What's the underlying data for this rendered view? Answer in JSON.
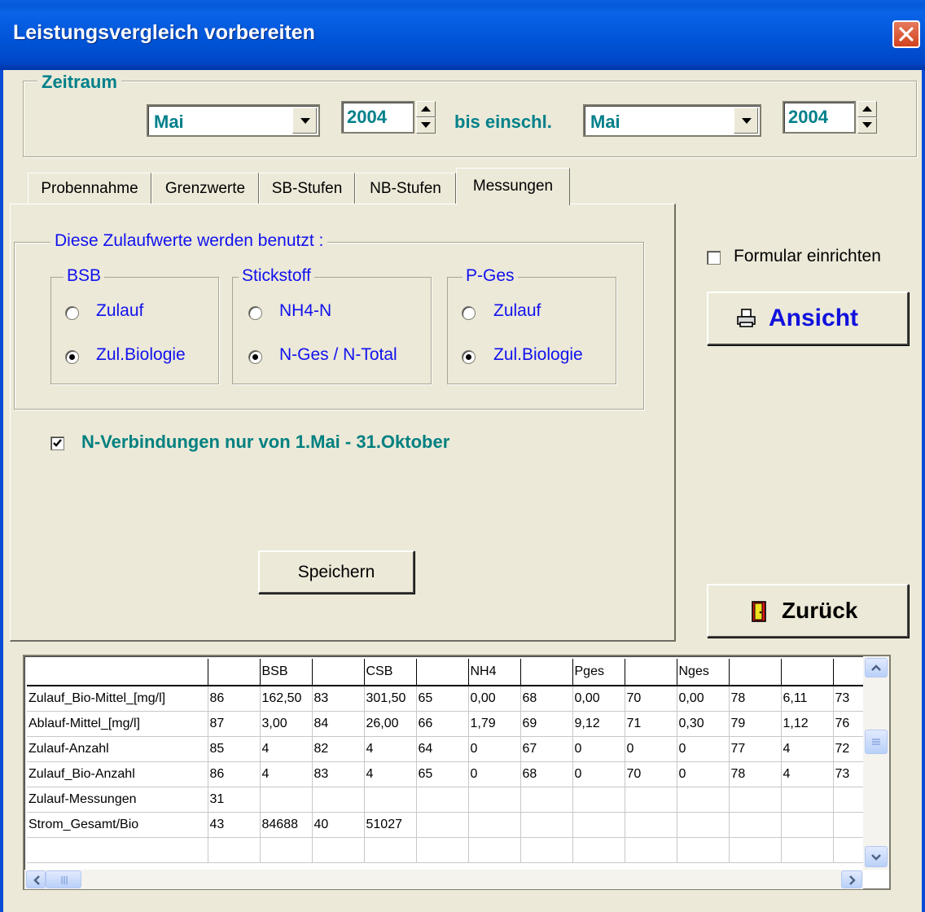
{
  "window": {
    "title": "Leistungsvergleich vorbereiten"
  },
  "zeitraum": {
    "label": "Zeitraum",
    "from_month": "Mai",
    "from_year": "2004",
    "bis_label": "bis einschl.",
    "to_month": "Mai",
    "to_year": "2004"
  },
  "tabs": [
    {
      "label": "Probennahme"
    },
    {
      "label": "Grenzwerte"
    },
    {
      "label": "SB-Stufen"
    },
    {
      "label": "NB-Stufen"
    },
    {
      "label": "Messungen",
      "active": true
    }
  ],
  "messungen": {
    "group_label": "Diese Zulaufwerte werden benutzt :",
    "bsb": {
      "label": "BSB",
      "opt1": "Zulauf",
      "opt2": "Zul.Biologie",
      "selected": "Zul.Biologie"
    },
    "stickstoff": {
      "label": "Stickstoff",
      "opt1": "NH4-N",
      "opt2": "N-Ges / N-Total",
      "selected": "N-Ges / N-Total"
    },
    "pges": {
      "label": "P-Ges",
      "opt1": "Zulauf",
      "opt2": "Zul.Biologie",
      "selected": "Zul.Biologie"
    },
    "nverb_label": "N-Verbindungen nur von 1.Mai - 31.Oktober",
    "nverb_checked": true,
    "save_label": "Speichern"
  },
  "right": {
    "formular_label": "Formular einrichten",
    "formular_checked": false,
    "ansicht_label": "Ansicht",
    "zurueck_label": "Zurück"
  },
  "grid": {
    "header": [
      "",
      "",
      "BSB",
      "",
      "CSB",
      "",
      "NH4",
      "",
      "Pges",
      "",
      "Nges",
      "",
      "",
      ""
    ],
    "rows": [
      [
        "Zulauf_Bio-Mittel_[mg/l]",
        "86",
        "162,50",
        "83",
        "301,50",
        "65",
        "0,00",
        "68",
        "0,00",
        "70",
        "0,00",
        "78",
        "6,11",
        "73"
      ],
      [
        "Ablauf-Mittel_[mg/l]",
        "87",
        "3,00",
        "84",
        "26,00",
        "66",
        "1,79",
        "69",
        "9,12",
        "71",
        "0,30",
        "79",
        "1,12",
        "76"
      ],
      [
        "Zulauf-Anzahl",
        "85",
        "4",
        "82",
        "4",
        "64",
        "0",
        "67",
        "0",
        "0",
        "0",
        "77",
        "4",
        "72"
      ],
      [
        "Zulauf_Bio-Anzahl",
        "86",
        "4",
        "83",
        "4",
        "65",
        "0",
        "68",
        "0",
        "70",
        "0",
        "78",
        "4",
        "73"
      ],
      [
        "Zulauf-Messungen",
        "31",
        "",
        "",
        "",
        "",
        "",
        "",
        "",
        "",
        "",
        "",
        "",
        ""
      ],
      [
        "Strom_Gesamt/Bio",
        "43",
        "84688",
        "40",
        "51027",
        "",
        "",
        "",
        "",
        "",
        "",
        "",
        "",
        ""
      ],
      [
        "",
        "",
        "",
        "",
        "",
        "",
        "",
        "",
        "",
        "",
        "",
        "",
        "",
        ""
      ]
    ]
  },
  "colors": {
    "accent_teal": "#00808a",
    "option_blue": "#1111ee",
    "titlebar": "#0053d6"
  }
}
